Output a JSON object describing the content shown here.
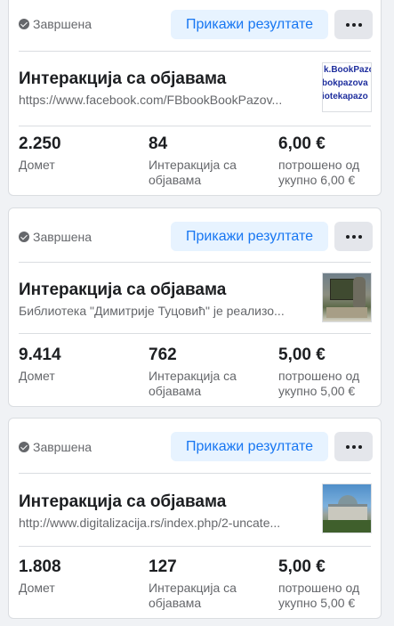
{
  "cards": [
    {
      "status": "Завршена",
      "results_button": "Прикажи резултате",
      "title": "Интеракција са објавама",
      "subtitle": "https://www.facebook.com/FBbookBookPazov...",
      "thumbnail_text": [
        "k.BookPazo",
        "bokpazova",
        "iotekapazo"
      ],
      "reach_value": "2.250",
      "reach_label": "Домет",
      "engagement_value": "84",
      "engagement_label": "Интеракција са објавама",
      "spent_value": "6,00 €",
      "spent_label": "потрошено од укупно 6,00 €"
    },
    {
      "status": "Завршена",
      "results_button": "Прикажи резултате",
      "title": "Интеракција са објавама",
      "subtitle": "Библиотека \"Димитрије Туцовић\" је реализо...",
      "reach_value": "9.414",
      "reach_label": "Домет",
      "engagement_value": "762",
      "engagement_label": "Интеракција са објавама",
      "spent_value": "5,00 €",
      "spent_label": "потрошено од укупно 5,00 €"
    },
    {
      "status": "Завршена",
      "results_button": "Прикажи резултате",
      "title": "Интеракција са објавама",
      "subtitle": "http://www.digitalizacija.rs/index.php/2-uncate...",
      "reach_value": "1.808",
      "reach_label": "Домет",
      "engagement_value": "127",
      "engagement_label": "Интеракција са објавама",
      "spent_value": "5,00 €",
      "spent_label": "потрошено од укупно 5,00 €"
    }
  ],
  "colors": {
    "accent": "#1877f2",
    "button_bg": "#e7f3ff",
    "secondary_text": "#65676b",
    "page_bg": "#f0f2f5"
  },
  "icons": {
    "status": "check-circle-icon",
    "more": "more-horizontal-icon"
  }
}
